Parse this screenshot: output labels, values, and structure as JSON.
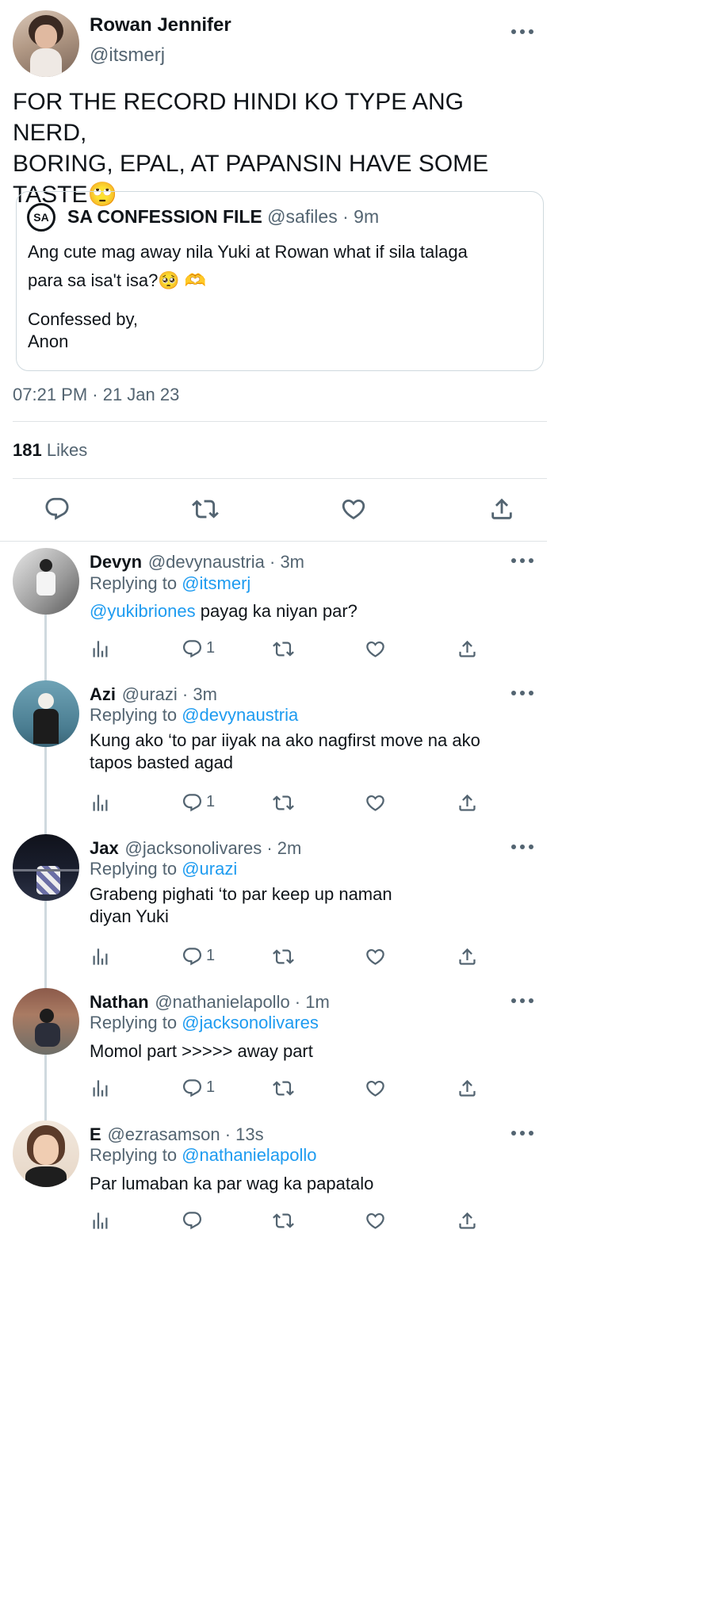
{
  "main_tweet": {
    "author_name": "Rowan Jennifer",
    "author_handle": "@itsmerj",
    "text_line1": "FOR THE RECORD HINDI KO TYPE ANG NERD,",
    "text_line2": "BORING, EPAL, AT PAPANSIN HAVE SOME",
    "text_line3": "TASTE🙄",
    "quoted": {
      "logo": "SA",
      "name": "SA CONFESSION FILE",
      "handle": "@safiles · 9m",
      "line1": "Ang cute mag away nila Yuki at Rowan what if sila talaga",
      "line2": "para sa isa't isa?🥺 🫶",
      "line3": "Confessed by,",
      "line4": "Anon"
    },
    "timestamp": "07:21 PM · 21 Jan 23",
    "likes_count": "181",
    "likes_label": "Likes"
  },
  "replies": [
    {
      "name": "Devyn",
      "meta": "@devynaustria · 3m",
      "replying_prefix": "Replying to ",
      "replying_to": "@itsmerj",
      "mention": "@yukibriones",
      "text": " payag ka niyan par?",
      "reply_count": "1"
    },
    {
      "name": "Azi",
      "meta": "@urazi · 3m",
      "replying_prefix": "Replying to ",
      "replying_to": "@devynaustria",
      "line1": "Kung ako ‘to par iiyak na ako nagfirst move na ako",
      "line2": "tapos basted agad",
      "reply_count": "1"
    },
    {
      "name": "Jax",
      "meta": "@jacksonolivares · 2m",
      "replying_prefix": "Replying to ",
      "replying_to": "@urazi",
      "line1": "Grabeng pighati ‘to par keep up naman",
      "line2": "diyan Yuki",
      "reply_count": "1"
    },
    {
      "name": "Nathan",
      "meta": "@nathanielapollo · 1m",
      "replying_prefix": "Replying to ",
      "replying_to": "@jacksonolivares",
      "line1": "Momol part >>>>> away part",
      "reply_count": "1"
    },
    {
      "name": "E",
      "meta": "@ezrasamson · 13s",
      "replying_prefix": "Replying to ",
      "replying_to": "@nathanielapollo",
      "line1": "Par lumaban ka par wag ka papatalo",
      "reply_count": ""
    }
  ],
  "icons": {
    "more": "more-icon",
    "reply": "reply-icon",
    "retweet": "retweet-icon",
    "like": "like-icon",
    "share": "share-icon",
    "views": "views-icon"
  },
  "colors": {
    "link": "#1d9bf0",
    "muted": "#536471",
    "text": "#0f1419",
    "border": "#dfe3e6"
  }
}
